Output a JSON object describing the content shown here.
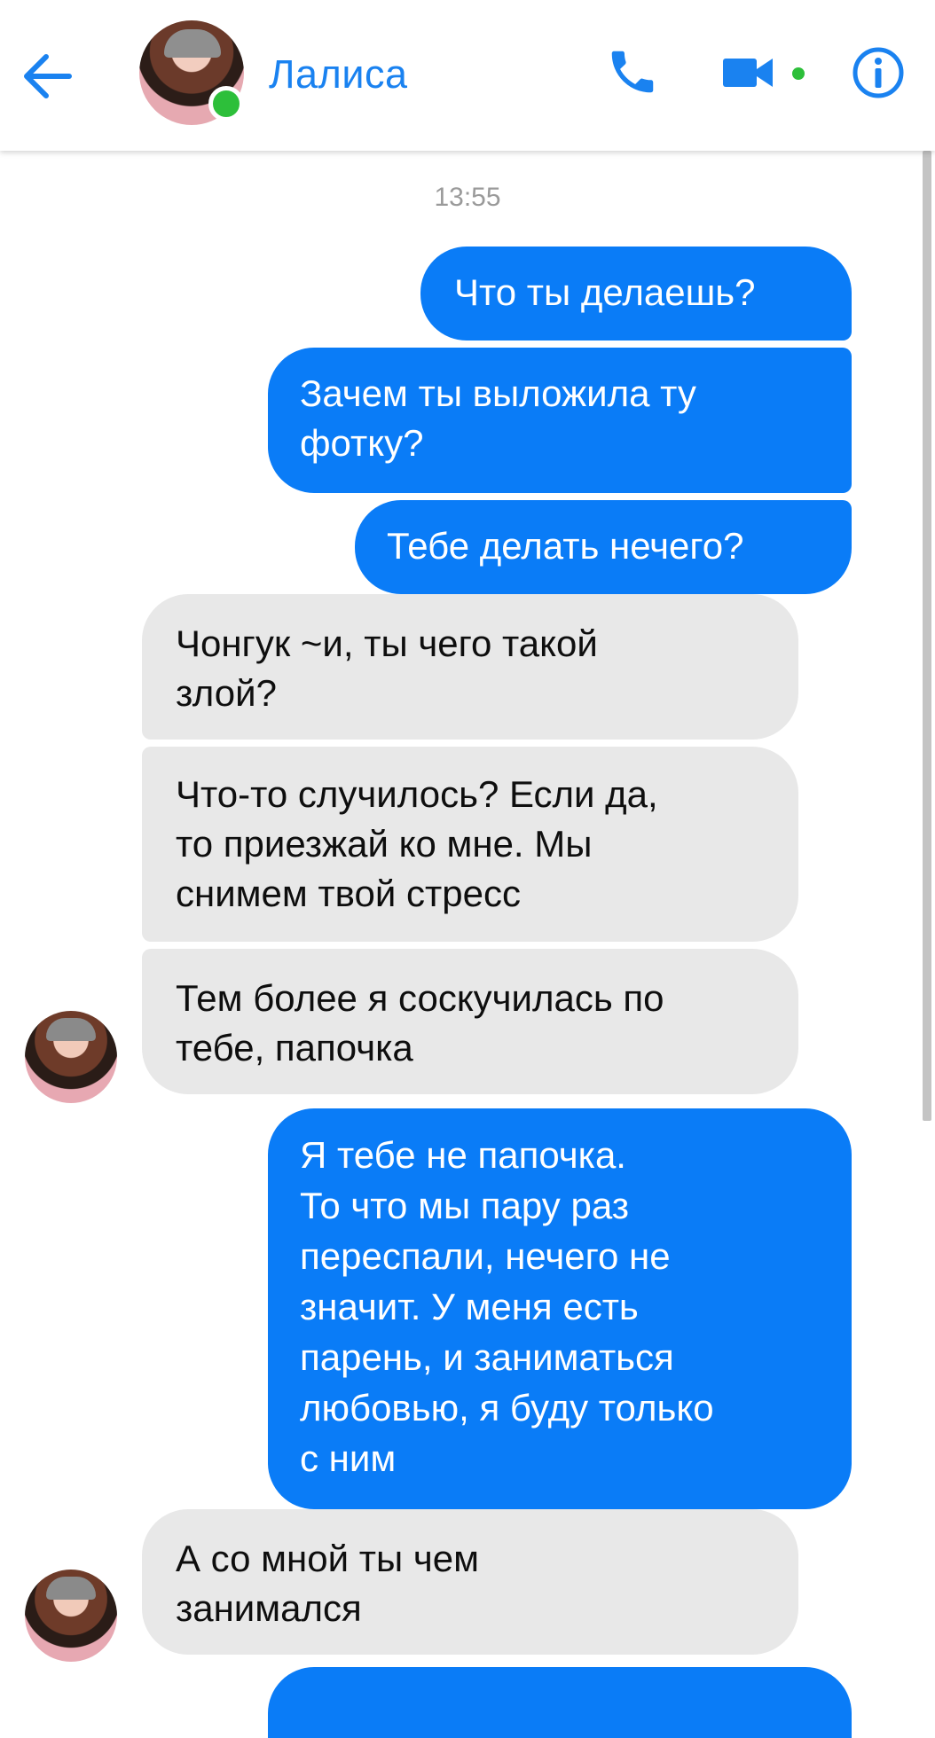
{
  "header": {
    "contact_name": "Лалиса",
    "online": true
  },
  "conversation": {
    "timestamp": "13:55",
    "messages": [
      {
        "direction": "outgoing",
        "lines": [
          "Что ты делаешь?"
        ]
      },
      {
        "direction": "outgoing",
        "lines": [
          "Зачем ты выложила ту",
          "фотку?"
        ]
      },
      {
        "direction": "outgoing",
        "lines": [
          "Тебе делать нечего?"
        ]
      },
      {
        "direction": "incoming",
        "lines": [
          "Чонгук ~и, ты чего такой",
          "злой?"
        ]
      },
      {
        "direction": "incoming",
        "lines": [
          "Что-то случилось? Если да,",
          "то приезжай ко мне. Мы",
          "снимем твой стресс"
        ]
      },
      {
        "direction": "incoming",
        "lines": [
          "Тем более я соскучилась по",
          "тебе, папочка"
        ]
      },
      {
        "direction": "outgoing",
        "lines": [
          "Я тебе не папочка.",
          "То что мы пару раз",
          "переспали, нечего не",
          "значит. У меня есть",
          "парень, и заниматься",
          "любовью, я буду только",
          "с ним"
        ]
      },
      {
        "direction": "incoming",
        "lines": [
          "А со мной ты чем",
          "занимался"
        ]
      }
    ]
  },
  "colors": {
    "accent": "#1a82f0",
    "outgoing_bubble": "#0a7cf7",
    "incoming_bubble": "#e8e8e8",
    "online": "#2dbf3a"
  },
  "icons": [
    "back-arrow-icon",
    "phone-icon",
    "video-camera-icon",
    "info-icon"
  ]
}
